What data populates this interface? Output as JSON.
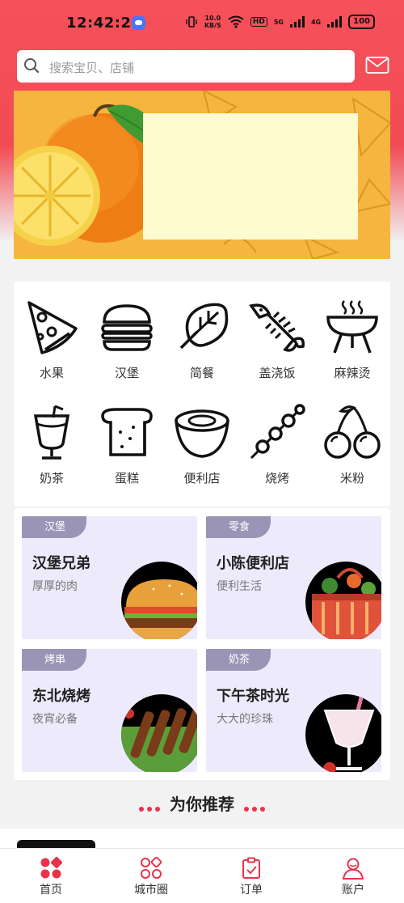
{
  "status_bar": {
    "time": "12:42:21",
    "net_speed_top": "10.0",
    "net_speed_bottom": "KB/S",
    "hd": "HD",
    "sig1": "5G",
    "sig2": "4G",
    "battery": "100"
  },
  "search": {
    "placeholder": "搜索宝贝、店铺"
  },
  "accent_color": "#e8334a",
  "categories": [
    {
      "label": "水果",
      "icon": "pizza-icon"
    },
    {
      "label": "汉堡",
      "icon": "burger-icon"
    },
    {
      "label": "简餐",
      "icon": "leaf-icon"
    },
    {
      "label": "盖浇饭",
      "icon": "fish-bone-icon"
    },
    {
      "label": "麻辣烫",
      "icon": "grill-icon"
    },
    {
      "label": "奶茶",
      "icon": "drink-cup-icon"
    },
    {
      "label": "蛋糕",
      "icon": "bread-icon"
    },
    {
      "label": "便利店",
      "icon": "bowl-icon"
    },
    {
      "label": "烧烤",
      "icon": "skewer-icon"
    },
    {
      "label": "米粉",
      "icon": "cherry-icon"
    }
  ],
  "shops": [
    {
      "tag": "汉堡",
      "name": "汉堡兄弟",
      "sub": "厚厚的肉"
    },
    {
      "tag": "零食",
      "name": "小陈便利店",
      "sub": "便利生活"
    },
    {
      "tag": "烤串",
      "name": "东北烧烤",
      "sub": "夜宵必备"
    },
    {
      "tag": "奶茶",
      "name": "下午茶时光",
      "sub": "大大的珍珠"
    }
  ],
  "recommend": {
    "title": "为你推荐"
  },
  "tabs": [
    {
      "label": "首页",
      "icon": "home-grid-icon",
      "active": true
    },
    {
      "label": "城市圈",
      "icon": "city-circle-icon",
      "active": false
    },
    {
      "label": "订单",
      "icon": "order-clipboard-icon",
      "active": false
    },
    {
      "label": "账户",
      "icon": "account-person-icon",
      "active": false
    }
  ]
}
